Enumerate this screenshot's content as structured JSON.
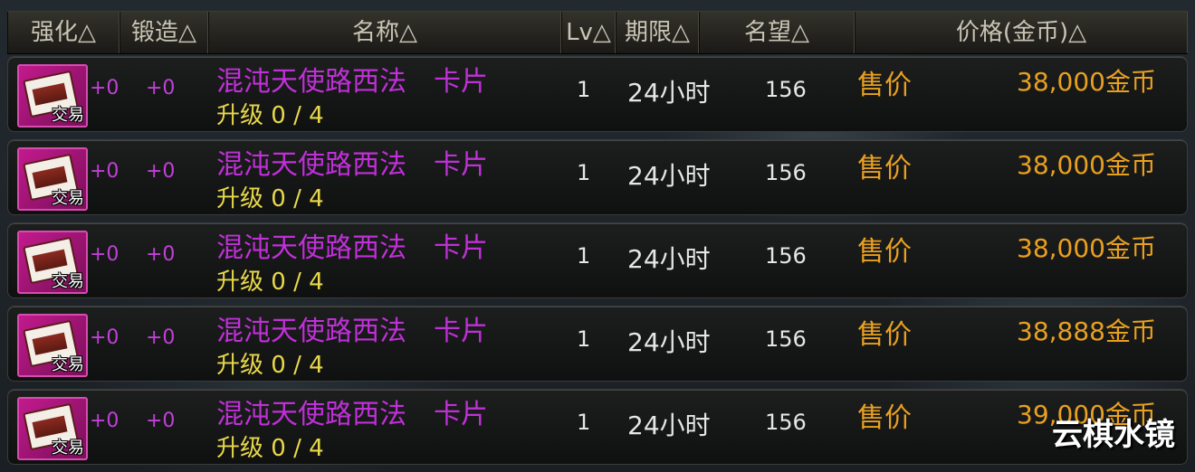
{
  "header": {
    "enhance": "强化△",
    "forge": "锻造△",
    "name": "名称△",
    "lv": "Lv△",
    "period": "期限△",
    "fame": "名望△",
    "price": "价格(金币)△"
  },
  "rows": [
    {
      "enhance": "+0",
      "forge": "+0",
      "name": "混沌天使路西法　卡片",
      "upgrade": "升级 0 / 4",
      "lv": "1",
      "period": "24小时",
      "fame": "156",
      "sell_label": "售价",
      "price": "38,000金币",
      "trade_label": "交易"
    },
    {
      "enhance": "+0",
      "forge": "+0",
      "name": "混沌天使路西法　卡片",
      "upgrade": "升级 0 / 4",
      "lv": "1",
      "period": "24小时",
      "fame": "156",
      "sell_label": "售价",
      "price": "38,000金币",
      "trade_label": "交易"
    },
    {
      "enhance": "+0",
      "forge": "+0",
      "name": "混沌天使路西法　卡片",
      "upgrade": "升级 0 / 4",
      "lv": "1",
      "period": "24小时",
      "fame": "156",
      "sell_label": "售价",
      "price": "38,000金币",
      "trade_label": "交易"
    },
    {
      "enhance": "+0",
      "forge": "+0",
      "name": "混沌天使路西法　卡片",
      "upgrade": "升级 0 / 4",
      "lv": "1",
      "period": "24小时",
      "fame": "156",
      "sell_label": "售价",
      "price": "38,888金币",
      "trade_label": "交易"
    },
    {
      "enhance": "+0",
      "forge": "+0",
      "name": "混沌天使路西法　卡片",
      "upgrade": "升级 0 / 4",
      "lv": "1",
      "period": "24小时",
      "fame": "156",
      "sell_label": "售价",
      "price": "39,000金币",
      "trade_label": "交易"
    }
  ],
  "watermark": "云棋水镜",
  "colors": {
    "item_name": "#c030d8",
    "upgrade": "#e8d84a",
    "price": "#e8a020",
    "icon_bg": "#c21a8c"
  },
  "icons": {
    "item": "card-item-icon"
  }
}
